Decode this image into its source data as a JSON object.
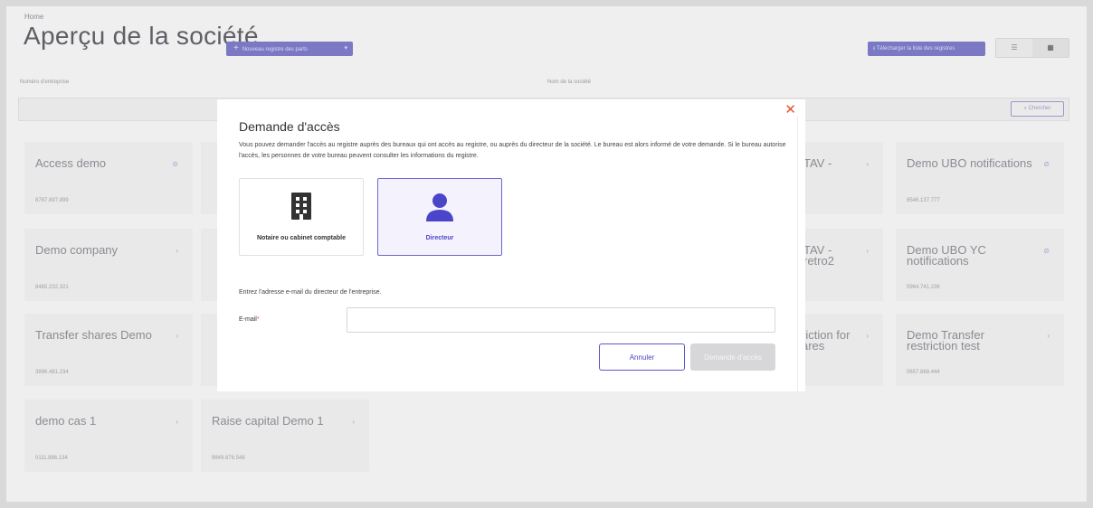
{
  "page": {
    "breadcrumb": "Home",
    "title": "Aperçu de la société",
    "new_register_button": "Nouveau registre des parts",
    "download_button": "Télécharger la liste des registres",
    "enterprise_number_label": "Numéro d'entreprise",
    "company_name_label": "Nom de la société",
    "search_button": "Chercher"
  },
  "cards": [
    {
      "name": "Access demo",
      "number": "8787.897.899",
      "icon": "block-icon"
    },
    {
      "name": "Demo company",
      "number": "8465.232.321",
      "icon": "chevron-right-icon"
    },
    {
      "name": "Transfer shares Demo",
      "number": "3896.481.234",
      "icon": "chevron-right-icon"
    },
    {
      "name": "demo cas 1",
      "number": "0111.886.134",
      "icon": "chevron-right-icon"
    },
    {
      "name": "Raise capital Demo 1",
      "number": "9849.876.548",
      "icon": "chevron-right-icon"
    },
    {
      "name": "Demo UBO notifications",
      "number": "8546.137.777",
      "icon": "block-icon"
    },
    {
      "name": "Demo UBO YC notifications",
      "number": "5964.741.236",
      "icon": "block-icon"
    },
    {
      "name": "Demo Transfer restriction test",
      "number": "0657.868.444",
      "icon": "chevron-right-icon"
    },
    {
      "name": "TAV -",
      "number": "",
      "icon": "chevron-right-icon"
    },
    {
      "name": "TAV - retro2",
      "number": "",
      "icon": "chevron-right-icon"
    },
    {
      "name": "riction for ares",
      "number": "",
      "icon": "chevron-right-icon"
    }
  ],
  "modal": {
    "title": "Demande d'accès",
    "description": "Vous pouvez demander l'accès au registre auprès des bureaux qui ont accès au registre, ou auprès du directeur de la société. Le bureau est alors informé de votre demande. Si le bureau autorise l'accès, les personnes de votre bureau peuvent consulter les informations du registre.",
    "option_notary": "Notaire ou cabinet comptable",
    "option_director": "Directeur",
    "selected_option": "Directeur",
    "email_hint": "Entrez l'adresse e-mail du directeur de l'entreprise.",
    "email_label": "E-mail",
    "email_required_mark": "*",
    "email_value": "",
    "cancel_button": "Annuler",
    "request_button": "Demande d'accès"
  },
  "colors": {
    "accent": "#5b56c9",
    "close": "#e3542e",
    "disabled_button": "#d7d7da"
  }
}
